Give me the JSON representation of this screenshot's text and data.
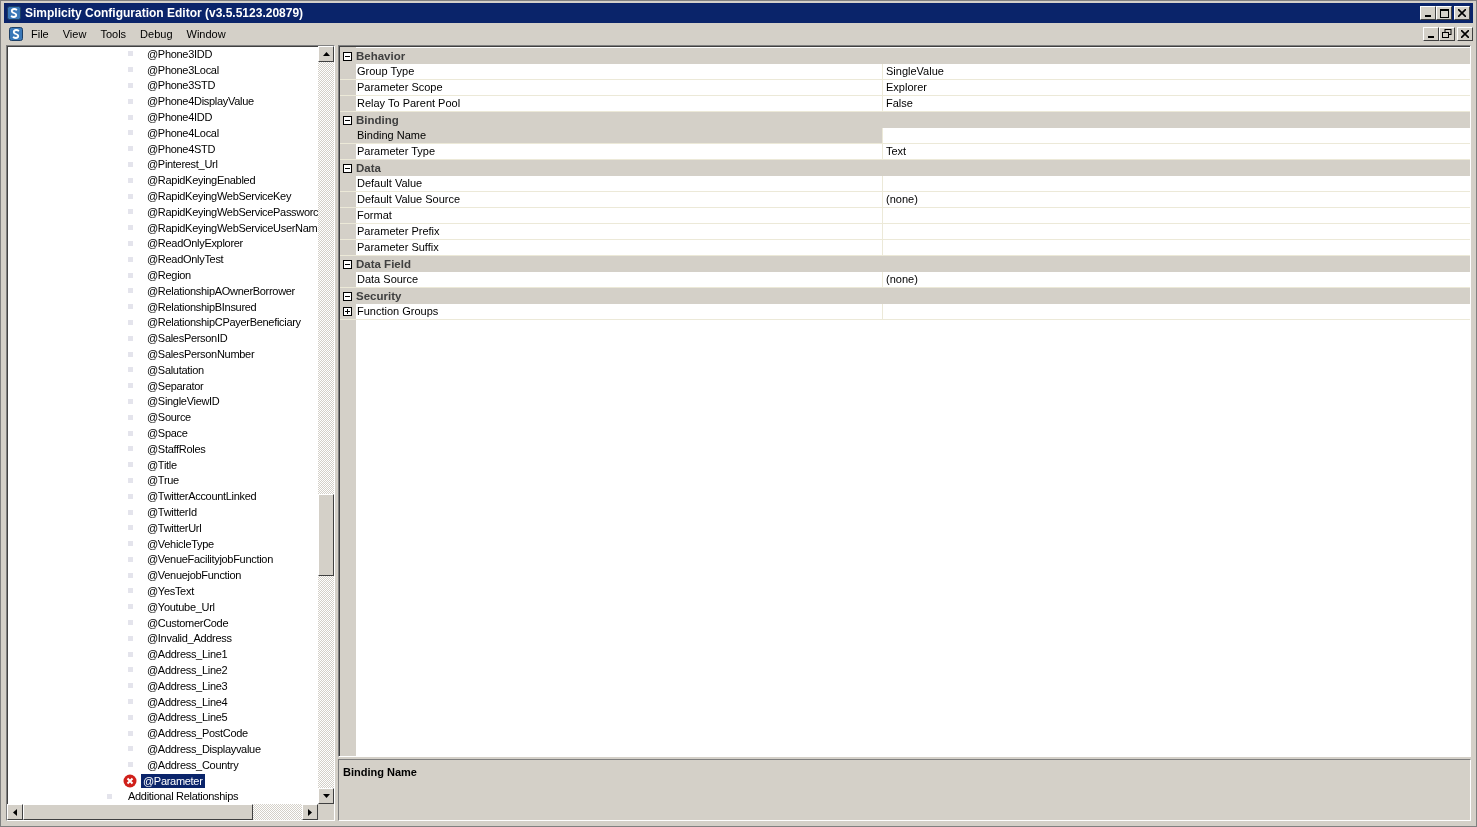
{
  "window": {
    "title": "Simplicity Configuration Editor (v3.5.5123.20879)"
  },
  "menu": [
    "File",
    "View",
    "Tools",
    "Debug",
    "Window"
  ],
  "tree": {
    "items": [
      {
        "label": "@Phone3IDD",
        "selected": false,
        "error": false
      },
      {
        "label": "@Phone3Local",
        "selected": false,
        "error": false
      },
      {
        "label": "@Phone3STD",
        "selected": false,
        "error": false
      },
      {
        "label": "@Phone4DisplayValue",
        "selected": false,
        "error": false
      },
      {
        "label": "@Phone4IDD",
        "selected": false,
        "error": false
      },
      {
        "label": "@Phone4Local",
        "selected": false,
        "error": false
      },
      {
        "label": "@Phone4STD",
        "selected": false,
        "error": false
      },
      {
        "label": "@Pinterest_Url",
        "selected": false,
        "error": false
      },
      {
        "label": "@RapidKeyingEnabled",
        "selected": false,
        "error": false
      },
      {
        "label": "@RapidKeyingWebServiceKey",
        "selected": false,
        "error": false
      },
      {
        "label": "@RapidKeyingWebServicePassworc",
        "selected": false,
        "error": false
      },
      {
        "label": "@RapidKeyingWebServiceUserNam",
        "selected": false,
        "error": false
      },
      {
        "label": "@ReadOnlyExplorer",
        "selected": false,
        "error": false
      },
      {
        "label": "@ReadOnlyTest",
        "selected": false,
        "error": false
      },
      {
        "label": "@Region",
        "selected": false,
        "error": false
      },
      {
        "label": "@RelationshipAOwnerBorrower",
        "selected": false,
        "error": false
      },
      {
        "label": "@RelationshipBInsured",
        "selected": false,
        "error": false
      },
      {
        "label": "@RelationshipCPayerBeneficiary",
        "selected": false,
        "error": false
      },
      {
        "label": "@SalesPersonID",
        "selected": false,
        "error": false
      },
      {
        "label": "@SalesPersonNumber",
        "selected": false,
        "error": false
      },
      {
        "label": "@Salutation",
        "selected": false,
        "error": false
      },
      {
        "label": "@Separator",
        "selected": false,
        "error": false
      },
      {
        "label": "@SingleViewID",
        "selected": false,
        "error": false
      },
      {
        "label": "@Source",
        "selected": false,
        "error": false
      },
      {
        "label": "@Space",
        "selected": false,
        "error": false
      },
      {
        "label": "@StaffRoles",
        "selected": false,
        "error": false
      },
      {
        "label": "@Title",
        "selected": false,
        "error": false
      },
      {
        "label": "@True",
        "selected": false,
        "error": false
      },
      {
        "label": "@TwitterAccountLinked",
        "selected": false,
        "error": false
      },
      {
        "label": "@TwitterId",
        "selected": false,
        "error": false
      },
      {
        "label": "@TwitterUrl",
        "selected": false,
        "error": false
      },
      {
        "label": "@VehicleType",
        "selected": false,
        "error": false
      },
      {
        "label": "@VenueFacilityjobFunction",
        "selected": false,
        "error": false
      },
      {
        "label": "@VenuejobFunction",
        "selected": false,
        "error": false
      },
      {
        "label": "@YesText",
        "selected": false,
        "error": false
      },
      {
        "label": "@Youtube_Url",
        "selected": false,
        "error": false
      },
      {
        "label": "@CustomerCode",
        "selected": false,
        "error": false
      },
      {
        "label": "@Invalid_Address",
        "selected": false,
        "error": false
      },
      {
        "label": "@Address_Line1",
        "selected": false,
        "error": false
      },
      {
        "label": "@Address_Line2",
        "selected": false,
        "error": false
      },
      {
        "label": "@Address_Line3",
        "selected": false,
        "error": false
      },
      {
        "label": "@Address_Line4",
        "selected": false,
        "error": false
      },
      {
        "label": "@Address_Line5",
        "selected": false,
        "error": false
      },
      {
        "label": "@Address_PostCode",
        "selected": false,
        "error": false
      },
      {
        "label": "@Address_Displayvalue",
        "selected": false,
        "error": false
      },
      {
        "label": "@Address_Country",
        "selected": false,
        "error": false
      },
      {
        "label": "@Parameter",
        "selected": true,
        "error": true
      }
    ],
    "parent_next": "Additional Relationships"
  },
  "properties": {
    "categories": [
      {
        "name": "Behavior",
        "expanded": true,
        "rows": [
          {
            "name": "Group Type",
            "value": "SingleValue",
            "selected": false
          },
          {
            "name": "Parameter Scope",
            "value": "Explorer",
            "selected": false
          },
          {
            "name": "Relay To Parent Pool",
            "value": "False",
            "selected": false
          }
        ]
      },
      {
        "name": "Binding",
        "expanded": true,
        "rows": [
          {
            "name": "Binding Name",
            "selected": true
          },
          {
            "name": "Parameter Type",
            "value": "Text",
            "selected": false
          }
        ]
      },
      {
        "name": "Data",
        "expanded": true,
        "rows": [
          {
            "name": "Default Value",
            "selected": false
          },
          {
            "name": "Default Value Source",
            "value": "(none)",
            "selected": false
          },
          {
            "name": "Format",
            "selected": false
          },
          {
            "name": "Parameter Prefix",
            "selected": false
          },
          {
            "name": "Parameter Suffix",
            "selected": false
          }
        ]
      },
      {
        "name": "Data Field",
        "expanded": true,
        "rows": [
          {
            "name": "Data Source",
            "value": "(none)",
            "selected": false
          }
        ]
      },
      {
        "name": "Security",
        "expanded": true,
        "rows": [
          {
            "name": "Function Groups",
            "selected": false,
            "kind": "group",
            "expanded": false
          }
        ]
      }
    ],
    "help_title": "Binding Name"
  }
}
